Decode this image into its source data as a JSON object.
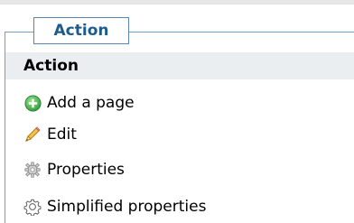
{
  "legend": {
    "title": "Action"
  },
  "menu": {
    "header": "Action",
    "items": [
      {
        "label": "Add a page",
        "icon": "add-circle-icon"
      },
      {
        "label": "Edit",
        "icon": "pencil-icon"
      },
      {
        "label": "Properties",
        "icon": "gear-icon"
      },
      {
        "label": "Simplified properties",
        "icon": "gear-outline-icon"
      }
    ]
  },
  "colors": {
    "legend_text": "#1d5b8a",
    "frame_border": "#7a9db9",
    "header_background": "#ebeef1",
    "add_icon": "#4caf50",
    "pencil_icon": "#e7b73a"
  }
}
